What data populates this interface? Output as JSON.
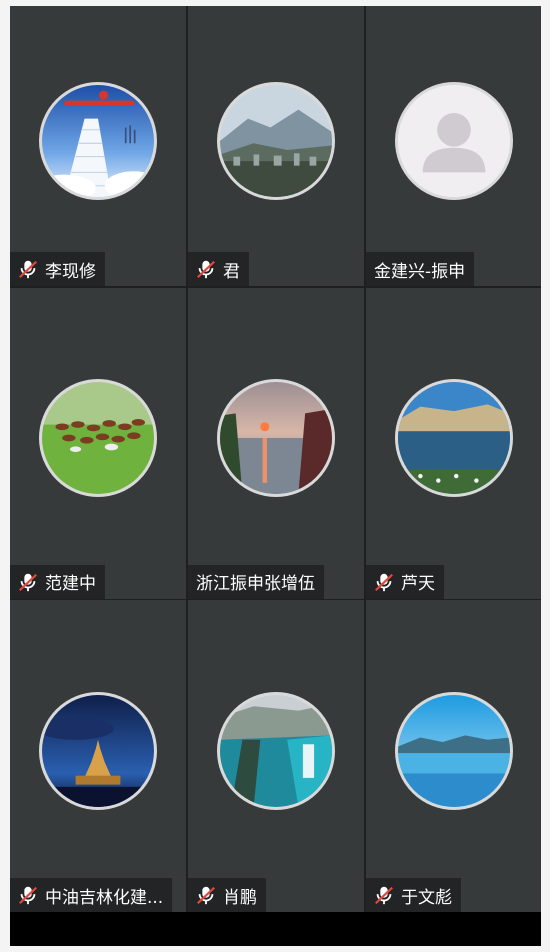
{
  "participants": [
    {
      "name": "李现修",
      "muted": true,
      "avatar": "stairway-to-clouds-picture"
    },
    {
      "name": "君",
      "muted": true,
      "avatar": "mountain-town-picture"
    },
    {
      "name": "金建兴-振申",
      "muted": false,
      "avatar": "default-person-icon"
    },
    {
      "name": "范建中",
      "muted": true,
      "avatar": "running-horses-picture"
    },
    {
      "name": "浙江振申张增伍",
      "muted": false,
      "avatar": "lake-sunset-picture"
    },
    {
      "name": "芦天",
      "muted": true,
      "avatar": "lake-cliffs-picture"
    },
    {
      "name": "中油吉林化建...",
      "muted": true,
      "avatar": "night-castle-picture"
    },
    {
      "name": "肖鹏",
      "muted": true,
      "avatar": "river-waterfall-picture"
    },
    {
      "name": "于文彪",
      "muted": true,
      "avatar": "calm-lake-picture"
    }
  ],
  "colors": {
    "tile_background": "#363a3b",
    "nameplate_background": "#222425",
    "muted_mic": "#e0473e"
  }
}
